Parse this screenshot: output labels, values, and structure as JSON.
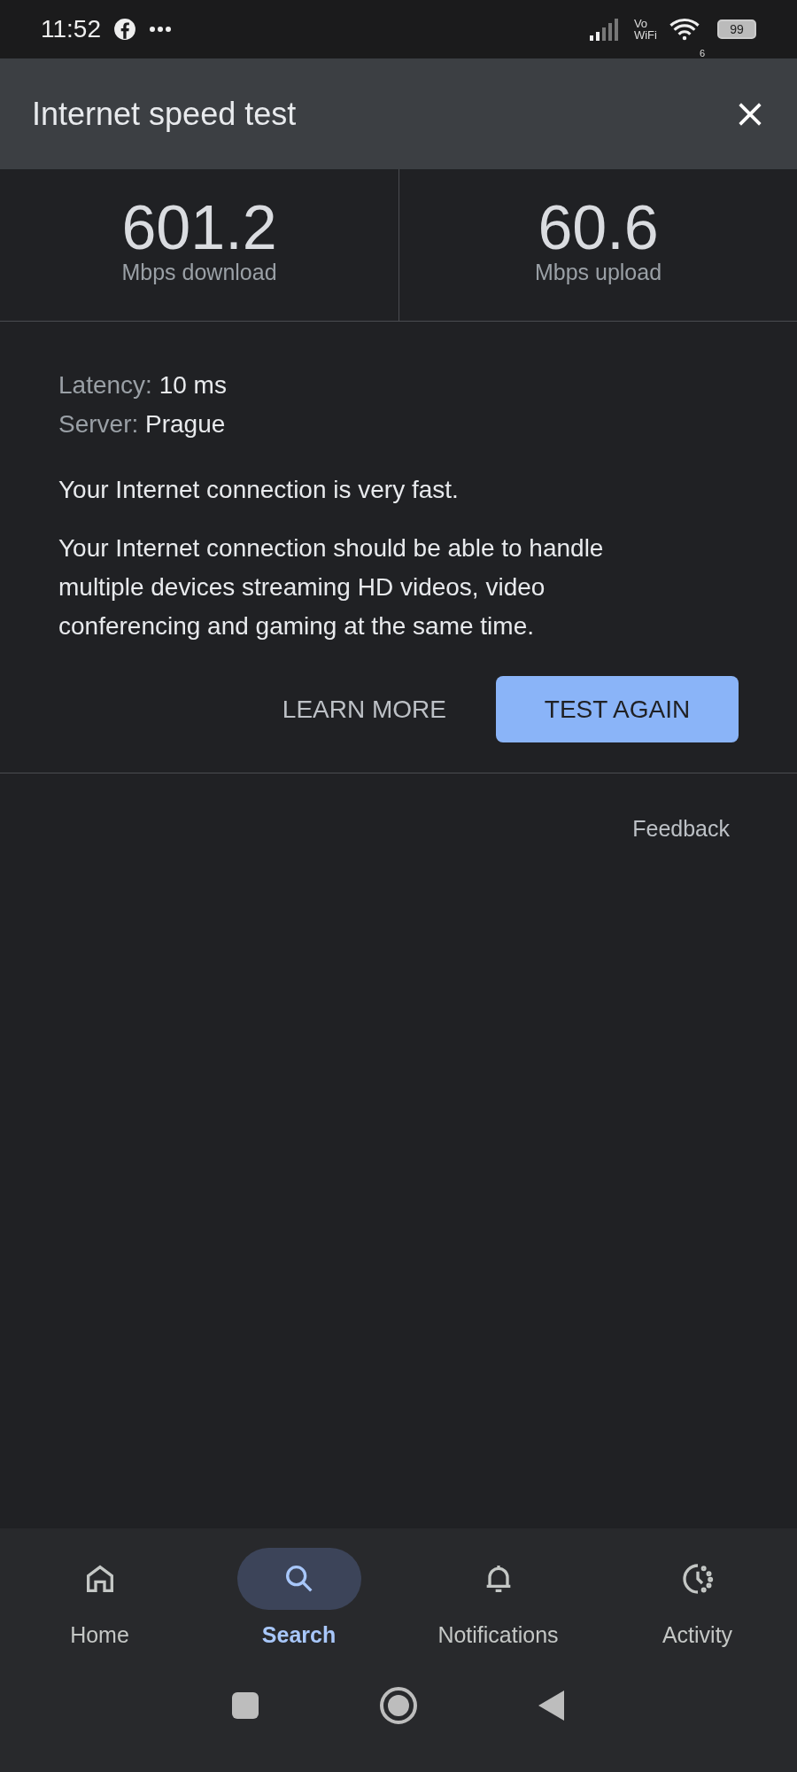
{
  "status_bar": {
    "time": "11:52",
    "vo": "Vo",
    "wifi_label": "WiFi",
    "wifi_band": "6",
    "battery": "99"
  },
  "header": {
    "title": "Internet speed test"
  },
  "results": [
    {
      "value": "601.2",
      "unit": "Mbps download"
    },
    {
      "value": "60.6",
      "unit": "Mbps upload"
    }
  ],
  "details": [
    {
      "label": "Latency:",
      "value": "10 ms"
    },
    {
      "label": "Server:",
      "value": "Prague"
    }
  ],
  "summary": "Your Internet connection is very fast.",
  "description": "Your Internet connection should be able to handle multiple devices streaming HD videos, video conferencing and gaming at the same time.",
  "actions": [
    {
      "label": "LEARN MORE",
      "kind": "text"
    },
    {
      "label": "TEST AGAIN",
      "kind": "filled"
    }
  ],
  "feedback": "Feedback",
  "nav": [
    {
      "label": "Home",
      "kind": "home",
      "selected": false
    },
    {
      "label": "Search",
      "kind": "search",
      "selected": true
    },
    {
      "label": "Notifications",
      "kind": "bell",
      "selected": false
    },
    {
      "label": "Activity",
      "kind": "activity",
      "selected": false
    }
  ]
}
